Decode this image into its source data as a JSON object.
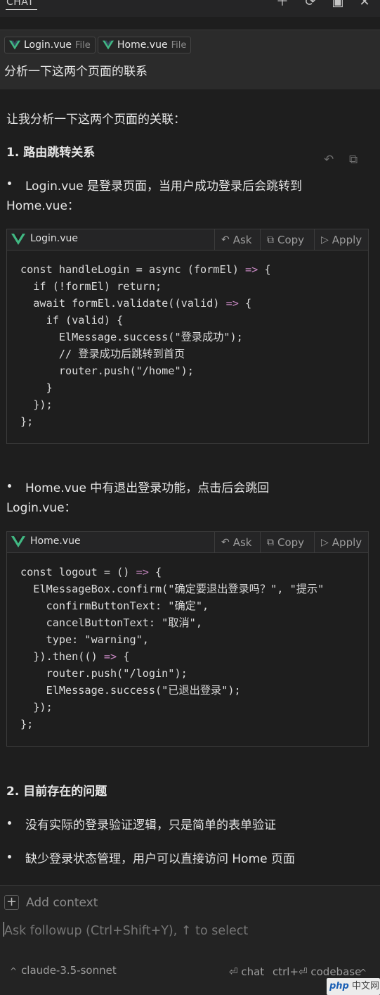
{
  "header": {
    "title": "CHAT",
    "icons": [
      "plus-icon",
      "history-icon",
      "split-icon",
      "close-icon"
    ]
  },
  "request": {
    "attachments": [
      {
        "name": "Login.vue",
        "type": "File"
      },
      {
        "name": "Home.vue",
        "type": "File"
      }
    ],
    "text": "分析一下这两个页面的联系"
  },
  "response": {
    "intro": "让我分析一下这两个页面的关联：",
    "section1_title": "1. 路由跳转关系",
    "bullet1_line1": "Login.vue 是登录页面，当用户成功登录后会跳转到",
    "bullet1_line2": "Home.vue：",
    "code1": {
      "filename": "Login.vue",
      "ask": "Ask",
      "copy": "Copy",
      "apply": "Apply",
      "lines": [
        "const handleLogin = async (formEl) => {",
        "  if (!formEl) return;",
        "  await formEl.validate((valid) => {",
        "    if (valid) {",
        "      ElMessage.success(\"登录成功\");",
        "      // 登录成功后跳转到首页",
        "      router.push(\"/home\");",
        "    }",
        "  });",
        "};"
      ]
    },
    "bullet2_line1": "Home.vue 中有退出登录功能，点击后会跳回",
    "bullet2_line2": "Login.vue：",
    "code2": {
      "filename": "Home.vue",
      "ask": "Ask",
      "copy": "Copy",
      "apply": "Apply",
      "lines": [
        "const logout = () => {",
        "  ElMessageBox.confirm(\"确定要退出登录吗？\", \"提示\"",
        "    confirmButtonText: \"确定\",",
        "    cancelButtonText: \"取消\",",
        "    type: \"warning\",",
        "  }).then(() => {",
        "    router.push(\"/login\");",
        "    ElMessage.success(\"已退出登录\");",
        "  });",
        "};"
      ]
    },
    "section2_title": "2. 目前存在的问题",
    "issue1": "没有实际的登录验证逻辑，只是简单的表单验证",
    "issue2": "缺少登录状态管理，用户可以直接访问 Home 页面"
  },
  "input": {
    "add_context": "Add context",
    "placeholder": "Ask followup (Ctrl+Shift+Y), ↑ to select",
    "model": "claude-3.5-sonnet",
    "chat_label": "⏎ chat",
    "codebase_label": "ctrl+⏎ codebase"
  },
  "watermark": {
    "brand": "php",
    "site": "中文网"
  },
  "colors": {
    "background": "#1e1e1e",
    "vue_green": "#41b883",
    "operator": "#c586c0"
  }
}
